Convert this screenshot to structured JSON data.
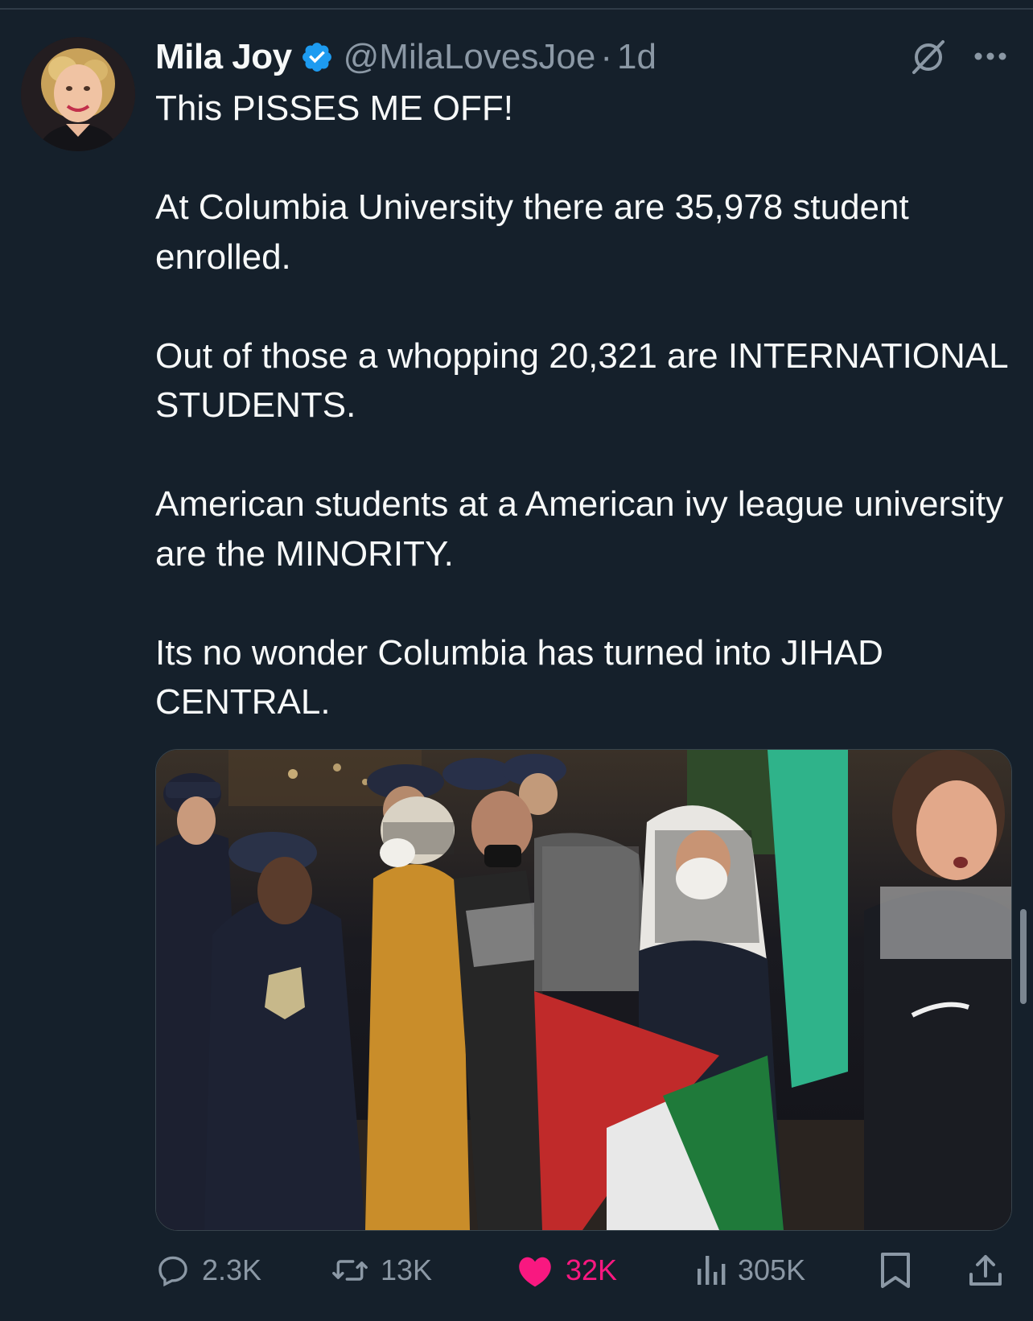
{
  "tweet": {
    "display_name": "Mila Joy",
    "handle": "@MilaLovesJoe",
    "separator": "·",
    "time": "1d",
    "verified_icon": "verified-badge-icon",
    "paragraphs": [
      "This PISSES ME  OFF!",
      "At Columbia University there are 35,978 student enrolled.",
      "Out of those a whopping 20,321 are INTERNATIONAL STUDENTS.",
      "American students at a American ivy league university are the MINORITY.",
      "Its no wonder Columbia has turned into JIHAD CENTRAL."
    ]
  },
  "actions": {
    "replies": "2.3K",
    "reposts": "13K",
    "likes": "32K",
    "views": "305K"
  },
  "colors": {
    "background": "#15202b",
    "text": "#f7f9f9",
    "secondary": "#8b98a5",
    "verified": "#1d9bf0",
    "like": "#f91880"
  },
  "icons": [
    "reply-icon",
    "repost-icon",
    "like-icon",
    "views-icon",
    "bookmark-icon",
    "share-icon",
    "grok-icon",
    "more-icon"
  ]
}
